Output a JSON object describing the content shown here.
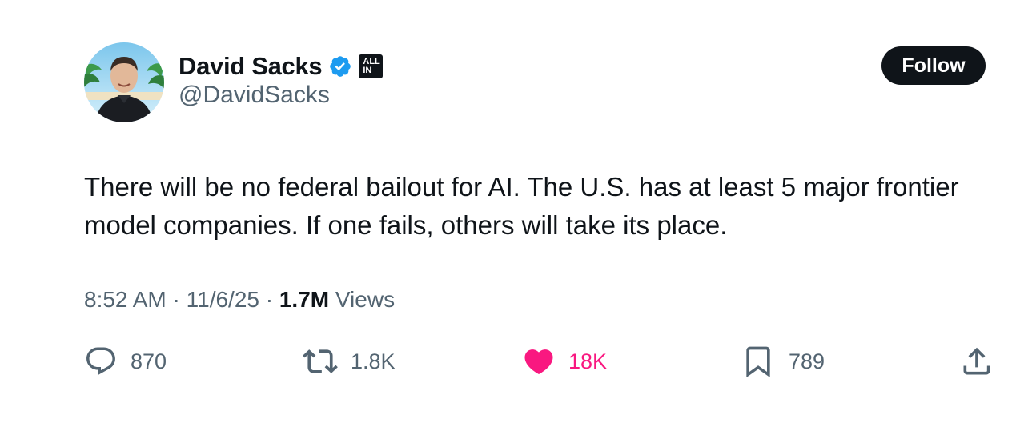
{
  "author": {
    "display_name": "David Sacks",
    "handle": "@DavidSacks",
    "verified": true,
    "verified_color": "#1d9bf0",
    "affiliate_badge": "ALL IN"
  },
  "follow_button": {
    "label": "Follow"
  },
  "tweet": {
    "text": "There will be no federal bailout for AI. The U.S. has at least 5 major frontier model companies. If one fails, others will take its place.",
    "time": "8:52 AM",
    "date": "11/6/25",
    "separator": "·",
    "views_count": "1.7M",
    "views_label": "Views"
  },
  "actions": {
    "replies": "870",
    "reposts": "1.8K",
    "likes": "18K",
    "bookmarks": "789"
  },
  "colors": {
    "text_primary": "#0f1419",
    "text_secondary": "#536471",
    "like_active": "#f91880",
    "button_bg": "#0f1419"
  }
}
